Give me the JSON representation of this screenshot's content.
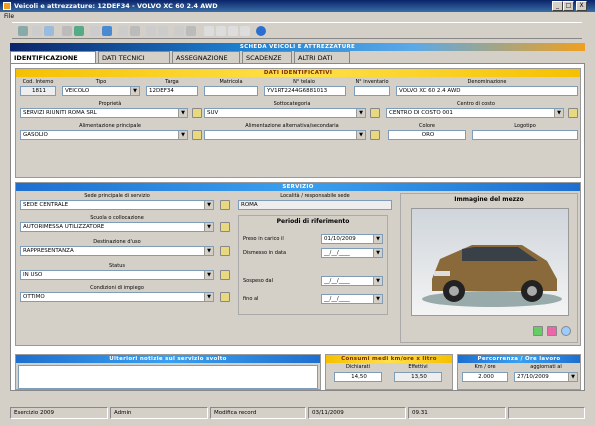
{
  "window": {
    "title": "Veicoli e attrezzature: 12DEF34 - VOLVO XC 60 2.4 AWD",
    "min": "_",
    "max": "□",
    "close": "X"
  },
  "menu": {
    "file": "File"
  },
  "header": {
    "title": "SCHEDA VEICOLI E ATTREZZATURE"
  },
  "tabs": [
    {
      "label": "IDENTIFICAZIONE"
    },
    {
      "label": "DATI TECNICI"
    },
    {
      "label": "ASSEGNAZIONE"
    },
    {
      "label": "SCADENZE"
    },
    {
      "label": "ALTRI DATI"
    }
  ],
  "id": {
    "title": "DATI IDENTIFICATIVI",
    "cod_interno_label": "Cod. Interno",
    "cod_interno": "1811",
    "tipo_label": "Tipo",
    "tipo": "VEICOLO",
    "targa_label": "Targa",
    "targa": "12DEF34",
    "matricola_label": "Matricola",
    "matricola": "",
    "telaio_label": "N° telaio",
    "telaio": "YV1RT2244G6881013",
    "inventario_label": "N° inventario",
    "inventario": "",
    "denominazione_label": "Denominazione",
    "denominazione": "VOLVO XC 60 2.4 AWD",
    "proprieta_label": "Proprietà",
    "proprieta": "SERVIZI RIUNITI ROMA  SRL",
    "sottocategoria_label": "Sottocategoria",
    "sottocategoria": "SUV",
    "centro_label": "Centro di costo",
    "centro": "CENTRO DI COSTO 001",
    "alim_label": "Alimentazione principale",
    "alim": "GASOLIO",
    "alim2_label": "Alimentazione alternativa/secondaria",
    "alim2": "",
    "colore_label": "Colore",
    "colore": "ORO",
    "logotipo_label": "Logotipo",
    "logotipo": ""
  },
  "servizio": {
    "title": "SERVIZIO",
    "sede_label": "Sede principale di servizio",
    "sede": "SEDE CENTRALE",
    "localita_label": "Località / responsabile sede",
    "localita": "ROMA",
    "scuola_label": "Scuola o collocazione",
    "scuola": "AUTORIMESSA UTILIZZATORE",
    "destinazione_label": "Destinazione d'uso",
    "destinazione": "RAPPRESENTANZA",
    "status_label": "Status",
    "status": "IN USO",
    "condizioni_label": "Condizioni di impiego",
    "condizioni": "OTTIMO",
    "periodi_title": "Periodi di riferimento",
    "preso_label": "Preso in carico il",
    "preso": "01/10/2009",
    "dismesso_label": "Dismesso in data",
    "dismesso": "__/__/____",
    "sospeso_label": "Sospeso dal",
    "sospeso": "__/__/____",
    "fino_label": "fino al",
    "fino": "__/__/____",
    "immagine_title": "Immagine del mezzo"
  },
  "notizie": {
    "title": "Ulteriori notizie sul servizio svolto",
    "text": ""
  },
  "consumi": {
    "title": "Consumi medi km/ore x litro",
    "dich_label": "Dichiarati",
    "dich": "14,50",
    "eff_label": "Effettivi",
    "eff": "13,50"
  },
  "percorrenza": {
    "title": "Percorrenza / Ore lavoro",
    "km_label": "Km / ore",
    "km": "2.000",
    "agg_label": "aggiornati al",
    "agg": "27/10/2009"
  },
  "status": {
    "esercizio": "Esercizio 2009",
    "utente": "Admin",
    "azione": "Modifica record",
    "data": "03/11/2009",
    "ora": "09.31"
  },
  "colors": {
    "accent_yellow": "#f5c000",
    "accent_blue": "#1e6fd0",
    "title_blue": "#0a246a"
  }
}
